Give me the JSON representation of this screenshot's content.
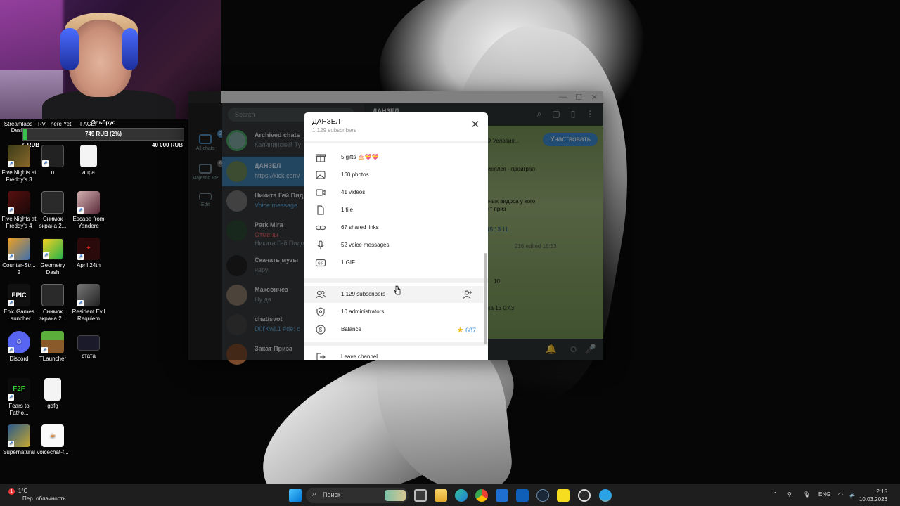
{
  "webcam": {
    "label": "Эльбрус"
  },
  "stream_widgets": {
    "labels": [
      "Streamlabs Deskt",
      "RV There Yet",
      "FACEIT"
    ],
    "donation": {
      "text": "749 RUB (2%)",
      "min": "0 RUB",
      "max": "40 000 RUB",
      "progress_fraction": 0.02
    }
  },
  "desktop_icons": [
    {
      "label": "Five Nights at Freddy's 3",
      "icon": "fnaf3-icon"
    },
    {
      "label": "тг",
      "icon": "tg-shortcut-icon"
    },
    {
      "label": "апра",
      "icon": "text-file-icon"
    },
    {
      "label": "Five Nights at Freddy's 4",
      "icon": "fnaf4-icon"
    },
    {
      "label": "Снимок экрана 2...",
      "icon": "screenshot-icon"
    },
    {
      "label": "Escape from Yandere",
      "icon": "game-icon"
    },
    {
      "label": "Counter-Str... 2",
      "icon": "cs2-icon"
    },
    {
      "label": "Geometry Dash",
      "icon": "geometry-dash-icon"
    },
    {
      "label": "April 24th",
      "icon": "game-icon"
    },
    {
      "label": "Epic Games Launcher",
      "icon": "epic-games-icon"
    },
    {
      "label": "Снимок экрана 2...",
      "icon": "screenshot-icon"
    },
    {
      "label": "Resident Evil Requiem",
      "icon": "resident-evil-icon"
    },
    {
      "label": "Discord",
      "icon": "discord-icon"
    },
    {
      "label": "TLauncher",
      "icon": "tlauncher-icon"
    },
    {
      "label": "стата",
      "icon": "image-icon"
    },
    {
      "label": "Fears to Fatho...",
      "icon": "f2f-icon"
    },
    {
      "label": "gdfg",
      "icon": "text-file-icon"
    },
    {
      "label": "Supernatural",
      "icon": "supernatural-icon"
    },
    {
      "label": "voicechat-f...",
      "icon": "java-icon"
    }
  ],
  "telegram": {
    "search_placeholder": "Search",
    "rail": [
      {
        "label": "All chats",
        "badge": "229"
      },
      {
        "label": "Majestic RP",
        "badge": "6"
      },
      {
        "label": "Edit",
        "badge": ""
      }
    ],
    "chats": [
      {
        "name": "Archived chats",
        "preview": "Калининский Ту"
      },
      {
        "name": "ДАНЗЕЛ",
        "preview": "https://kick.com/"
      },
      {
        "name": "Никита Гей Пид",
        "preview": "Voice message"
      },
      {
        "name": "Park Mira",
        "preview": "Отмены"
      },
      {
        "name": "Скачать музы",
        "preview": "нару"
      },
      {
        "name": "Максончез",
        "preview": "Ну да"
      },
      {
        "name": "chat/svot",
        "preview": "D0l'KwL1 #de: c"
      },
      {
        "name": "Закат Приза",
        "preview": ""
      }
    ],
    "extra_preview": "Никита Гей Пидо",
    "chat_header": {
      "title": "ДАНЗЕЛ"
    },
    "join_button": "Участвовать",
    "messages": [
      "тис 😄 Условия...",
      "асмеялся - проиграл",
      "ешных видоса у кого\nитит приз",
      "15   13   11",
      "216  edited 15:33",
      "10",
      "ка   13  0:43"
    ]
  },
  "modal": {
    "title": "ДАНЗЕЛ",
    "subtitle": "1 129 subscribers",
    "media_rows": [
      {
        "label": "5 gifts 🎂💝💝",
        "icon": "gift-icon"
      },
      {
        "label": "160 photos",
        "icon": "photo-icon"
      },
      {
        "label": "41 videos",
        "icon": "video-icon"
      },
      {
        "label": "1 file",
        "icon": "file-icon"
      },
      {
        "label": "67 shared links",
        "icon": "link-icon"
      },
      {
        "label": "52 voice messages",
        "icon": "microphone-icon"
      },
      {
        "label": "1 GIF",
        "icon": "gif-icon"
      }
    ],
    "admin_rows": [
      {
        "label": "1 129 subscribers",
        "icon": "people-icon",
        "right": ""
      },
      {
        "label": "10 administrators",
        "icon": "shield-icon",
        "right": ""
      },
      {
        "label": "Balance",
        "icon": "dollar-icon",
        "right": "687"
      }
    ],
    "leave_label": "Leave channel"
  },
  "taskbar": {
    "weather_temp": "-1°C",
    "weather_desc": "Пер. облачность",
    "search_placeholder": "Поиск",
    "lang": "ENG",
    "time": "2:15",
    "date": "10.03.2026",
    "notif_badge": "1"
  }
}
